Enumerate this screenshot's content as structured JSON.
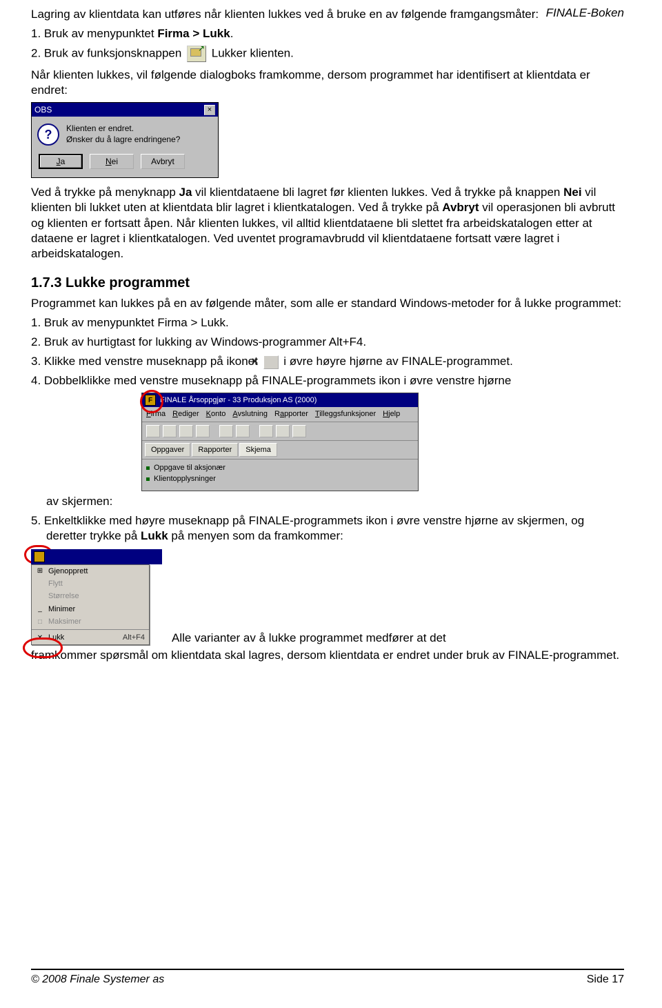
{
  "header": {
    "book": "FINALE-Boken"
  },
  "intro": {
    "p1": "Lagring av klientdata kan utføres når klienten lukkes ved å bruke en av følgende framgangsmåter:",
    "i1_pre": "1.  Bruk av menypunktet ",
    "i1_bold": "Firma > Lukk",
    "i1_post": ".",
    "i2_pre": "2.  Bruk av funksjonsknappen ",
    "i2_post": " Lukker klienten.",
    "p2": "Når klienten lukkes, vil følgende dialogboks framkomme, dersom programmet har identifisert at klientdata er endret:"
  },
  "dlg": {
    "title": "OBS",
    "line1": "Klienten er endret.",
    "line2": "Ønsker du å lagre endringene?",
    "btn_ja": "Ja",
    "btn_nei": "Nei",
    "btn_avbryt": "Avbryt"
  },
  "paraJa": {
    "pre": "Ved å trykke på menyknapp ",
    "ja": "Ja",
    "mid1": " vil klientdataene bli lagret før klienten lukkes. Ved å trykke på knappen ",
    "nei": "Nei",
    "mid2": " vil klienten bli lukket uten at klientdata blir lagret i klientkatalogen. Ved å trykke på ",
    "avbryt": "Avbryt",
    "post": " vil operasjonen bli avbrutt og klienten er fortsatt åpen. Når klienten lukkes, vil alltid klientdataene bli slettet fra arbeidskatalogen etter at dataene er lagret i klientkatalogen. Ved uventet programavbrudd vil klientdataene fortsatt være lagret i arbeidskatalogen."
  },
  "h173": "1.7.3 Lukke programmet",
  "sec173": {
    "p": "Programmet kan lukkes på en av følgende måter, som alle er standard Windows-metoder for å lukke programmet:",
    "l1": "1.  Bruk av menypunktet Firma > Lukk.",
    "l2": "2.  Bruk av hurtigtast for lukking av Windows-programmer Alt+F4.",
    "l3_pre": "3.  Klikke med venstre museknapp på ikonet ",
    "l3_post": "  i øvre høyre hjørne av FINALE-programmet.",
    "l4": "4.  Dobbelklikke med venstre museknapp på FINALE-programmets ikon i øvre venstre hjørne",
    "l4_tail": "av skjermen:",
    "l5_pre": "5.  Enkeltklikke med høyre museknapp på FINALE-programmets ikon i øvre venstre hjørne av skjermen, og deretter trykke på ",
    "l5_bold": "Lukk",
    "l5_post": " på menyen som da framkommer:",
    "final_inline": "Alle varianter av å lukke programmet medfører at det",
    "final_rest": "framkommer spørsmål om klientdata skal lagres, dersom klientdata er endret under bruk av FINALE-programmet."
  },
  "appwin": {
    "title": "FINALE Årsoppgjør - 33 Produksjon AS (2000)",
    "menus": [
      "Firma",
      "Rediger",
      "Konto",
      "Avslutning",
      "Rapporter",
      "Tilleggsfunksjoner",
      "Hjelp"
    ],
    "tabs": [
      "Oppgaver",
      "Rapporter",
      "Skjema"
    ],
    "list": [
      "Oppgave til aksjonær",
      "Klientopplysninger"
    ]
  },
  "sysmenu": {
    "tbar_text": "",
    "items": [
      {
        "label": "Gjenopprett",
        "icon": "⊞",
        "dis": false
      },
      {
        "label": "Flytt",
        "icon": "",
        "dis": true
      },
      {
        "label": "Størrelse",
        "icon": "",
        "dis": true
      },
      {
        "label": "Minimer",
        "icon": "_",
        "dis": false
      },
      {
        "label": "Maksimer",
        "icon": "□",
        "dis": true
      }
    ],
    "lukk": {
      "label": "Lukk",
      "icon": "✕",
      "shortcut": "Alt+F4"
    }
  },
  "footer": {
    "left": "© 2008 Finale Systemer as",
    "right": "Side 17"
  }
}
